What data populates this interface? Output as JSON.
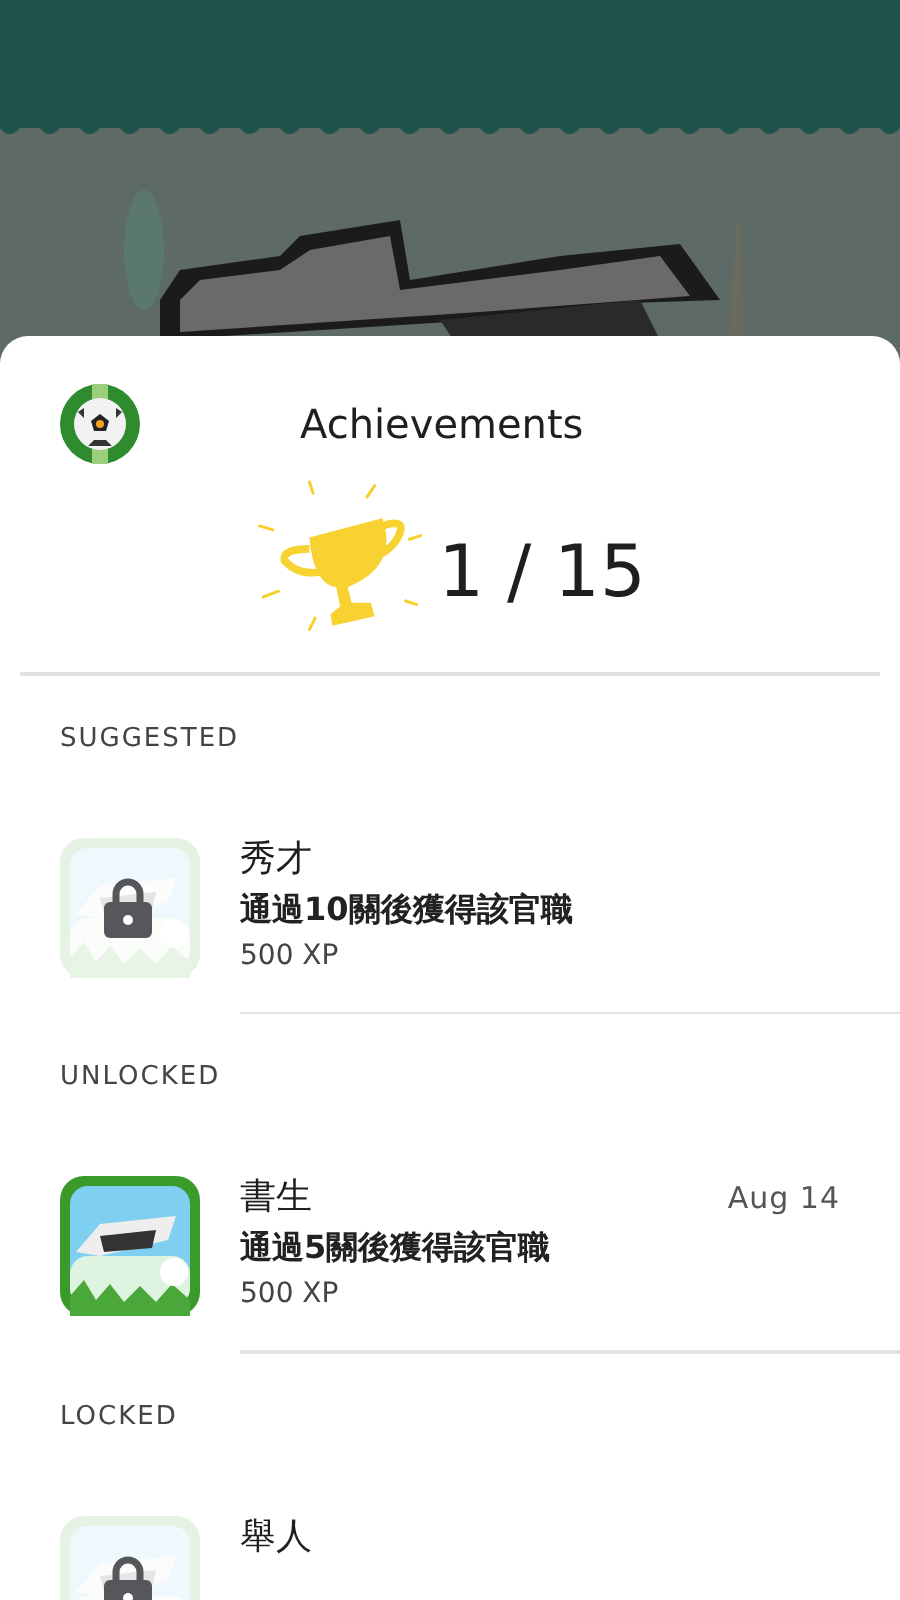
{
  "sheet": {
    "title": "Achievements",
    "progress": "1 / 15"
  },
  "sections": [
    {
      "label": "SUGGESTED",
      "items": [
        {
          "title": "秀才",
          "description": "通過10關後獲得該官職",
          "xp": "500 XP",
          "unlocked": false
        }
      ]
    },
    {
      "label": "UNLOCKED",
      "items": [
        {
          "title": "書生",
          "description": "通過5關後獲得該官職",
          "xp": "500 XP",
          "date": "Aug 14",
          "unlocked": true
        }
      ]
    },
    {
      "label": "LOCKED",
      "items": [
        {
          "title": "舉人",
          "unlocked": false
        }
      ]
    }
  ]
}
